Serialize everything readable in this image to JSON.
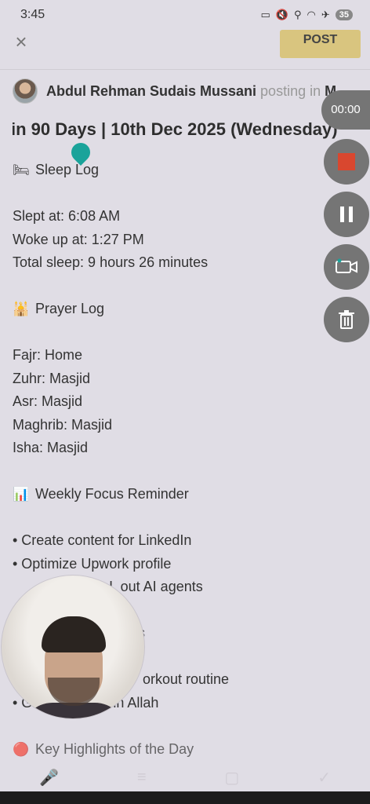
{
  "status_bar": {
    "time": "3:45",
    "battery": "35",
    "icons": [
      "cast-icon",
      "mute-icon",
      "location-icon",
      "wifi-icon",
      "airplane-icon"
    ]
  },
  "toolbar": {
    "post_label": "POST"
  },
  "author": {
    "name": "Abdul Rehman Sudais Mussani",
    "posting_in": "posting in",
    "group": "M..."
  },
  "post": {
    "title": "in 90 Days | 10th Dec 2025 (Wednesday)",
    "sleep": {
      "emoji": "🛏",
      "heading": "Sleep Log",
      "lines": [
        "Slept at: 6:08 AM",
        "Woke up at: 1:27 PM",
        "Total sleep: 9 hours 26 minutes"
      ]
    },
    "prayer": {
      "emoji": "🕌",
      "heading": "Prayer Log",
      "lines": [
        "Fajr: Home",
        "Zuhr: Masjid",
        "Asr: Masjid",
        "Maghrib: Masjid",
        "Isha: Masjid"
      ]
    },
    "focus": {
      "emoji": "📊",
      "heading": "Weekly Focus Reminder",
      "lines": [
        "• Create content for LinkedIn",
        "• Optimize Upwork profile",
        "• L out AI agents",
        "",
        "s",
        "",
        "orkout routine",
        "• Gi st and trust in Allah"
      ]
    },
    "highlights": {
      "emoji": "🔴",
      "heading": "Key Highlights of the Day"
    }
  },
  "recorder": {
    "timer": "00:00"
  },
  "colors": {
    "post_button": "#d9c57f",
    "stop": "#d9472f",
    "handle": "#1aa39a"
  }
}
